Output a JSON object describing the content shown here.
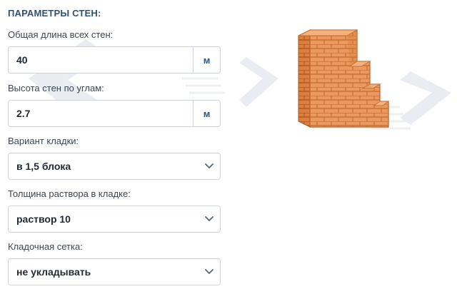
{
  "section": {
    "title": "ПАРАМЕТРЫ СТЕН:"
  },
  "fields": {
    "wall_length": {
      "label": "Общая длина всех стен:",
      "value": "40",
      "unit": "м"
    },
    "wall_height": {
      "label": "Высота стен по углам:",
      "value": "2.7",
      "unit": "м"
    },
    "masonry_variant": {
      "label": "Вариант кладки:",
      "selected": "в 1,5 блока"
    },
    "mortar_thickness": {
      "label": "Толщина раствора в кладке:",
      "selected": "раствор 10"
    },
    "masonry_mesh": {
      "label": "Кладочная сетка:",
      "selected": "не укладывать"
    }
  },
  "icons": {
    "dropdown": "chevron-down-icon",
    "illustration": "brick-wall-illustration"
  },
  "colors": {
    "title": "#31516e",
    "unit": "#30557a",
    "brick": "#e8955a",
    "watermark": "#e9edf1"
  }
}
